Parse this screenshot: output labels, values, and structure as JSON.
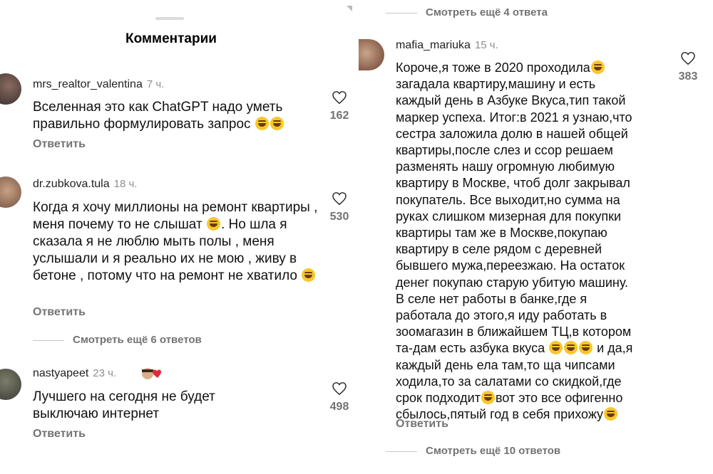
{
  "header": {
    "title": "Комментарии"
  },
  "left_comments": [
    {
      "username": "mrs_realtor_valentina",
      "time": "7 ч.",
      "text": "Вселенная это как ChatGPT надо уметь правильно формулировать запрос",
      "emoji": "😂😂",
      "reply": "Ответить",
      "likes": "162"
    },
    {
      "username": "dr.zubkova.tula",
      "time": "18 ч.",
      "text": "Когда я хочу миллионы  на ремонт квартиры , меня почему то не слышат",
      "text2": ". Но шла я сказала я не люблю мыть полы , меня услышали и я реально их не мою , живу в бетоне , потому что на ремонт не хватило",
      "reply": "Ответить",
      "likes": "530",
      "more_replies": "Смотреть ещё 6 ответов"
    },
    {
      "username": "nastyapeet",
      "time": "23 ч.",
      "text_lines": [
        "Лучшего на сегодня не будет",
        "выключаю интернет"
      ],
      "reply": "Ответить",
      "likes": "498"
    }
  ],
  "right_panel": {
    "more_replies_top": "Смотреть ещё 4 ответа",
    "comment": {
      "username": "mafia_mariuka",
      "time": "15 ч.",
      "lines": [
        "Короче,я тоже в 2020 проходила",
        "загадала квартиру,машину и есть",
        "каждый день в Азбуке Вкуса,тип такой",
        "маркер успеха. Итог:в 2021 я узнаю,что",
        "сестра заложила долю в нашей общей",
        "квартиры,после слез и ссор решаем",
        "разменять нашу огромную любимую",
        "квартиру в Москве, чтоб долг закрывал",
        "покупатель. Все выходит,но сумма на",
        "руках слишком мизерная для покупки",
        "квартиры там же в Москве,покупаю",
        "квартиру в селе рядом с деревней",
        "бывшего мужа,переезжаю. На остаток",
        "денег покупаю старую убитую машину.",
        "В селе нет работы в банке,где я",
        "работала до этого,я иду работать в",
        "зоомагазин в ближайшем ТЦ,в котором",
        "та-дам есть азбука вкуса",
        " и да,я",
        "каждый день ела там,то ща чипсами",
        "ходила,то за салатами со скидкой,где",
        "срок подходит",
        "вот это все офигенно",
        "сбылось,пятый год в себя прихожу"
      ],
      "reply": "Ответить",
      "likes": "383"
    },
    "more_replies_bottom": "Смотреть ещё 10 ответов"
  }
}
